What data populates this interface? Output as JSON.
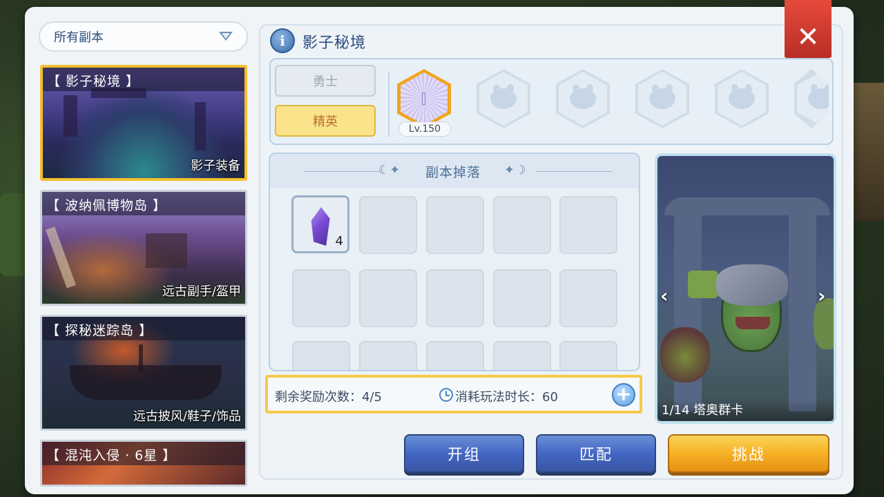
{
  "filter": {
    "selected": "所有副本"
  },
  "dungeons": [
    {
      "title": "【 影子秘境 】",
      "reward": "影子装备",
      "active": true
    },
    {
      "title": "【 波纳佩博物岛 】",
      "reward": "远古副手/盔甲",
      "active": false
    },
    {
      "title": "【 探秘迷踪岛 】",
      "reward": "远古披风/鞋子/饰品",
      "active": false
    },
    {
      "title": "【 混沌入侵 · 6星 】",
      "reward": "",
      "active": false
    }
  ],
  "header": {
    "info_icon": "info-icon",
    "title": "影子秘境",
    "close_symbol": "✕"
  },
  "difficulty": {
    "options": [
      "勇士",
      "精英"
    ],
    "selected": "精英"
  },
  "stage": {
    "level_label": "Lv.150"
  },
  "drops": {
    "title": "副本掉落",
    "items": [
      {
        "icon": "purple-crystal-icon",
        "count": "4"
      }
    ]
  },
  "rewards": {
    "remaining_label": "剩余奖励次数：4/5",
    "time_label": "消耗玩法时长：60"
  },
  "boss": {
    "counter": "1/14",
    "name": "塔奥群卡",
    "prev_symbol": "‹",
    "next_symbol": "›"
  },
  "actions": {
    "team": "开组",
    "match": "匹配",
    "challenge": "挑战"
  },
  "colors": {
    "selection_gold": "#f2c02d",
    "button_blue": "#4366c4",
    "button_orange": "#f6b225",
    "title_blue": "#2d4c7e"
  }
}
